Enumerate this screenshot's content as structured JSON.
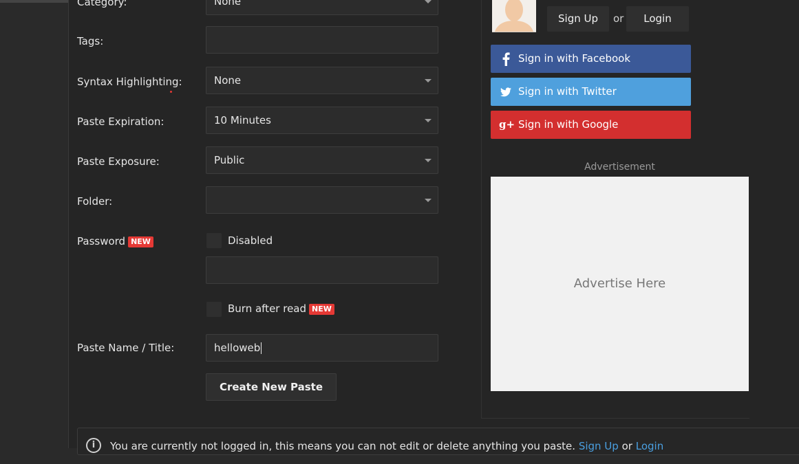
{
  "form": {
    "category": {
      "label": "Category:",
      "value": "None"
    },
    "tags": {
      "label": "Tags:",
      "value": ""
    },
    "syntax": {
      "label": "Syntax Highlighting:",
      "value": "None"
    },
    "expiration": {
      "label": "Paste Expiration:",
      "value": "10 Minutes"
    },
    "exposure": {
      "label": "Paste Exposure:",
      "value": "Public"
    },
    "folder": {
      "label": "Folder:",
      "value": ""
    },
    "password": {
      "label": "Password",
      "badge": "NEW",
      "checkbox_label": "Disabled",
      "value": ""
    },
    "burn": {
      "label": "Burn after read",
      "badge": "NEW"
    },
    "title": {
      "label": "Paste Name / Title:",
      "value": "helloweb"
    },
    "submit_label": "Create New Paste"
  },
  "auth": {
    "signup_label": "Sign Up",
    "or_text": "or",
    "login_label": "Login",
    "facebook_label": "Sign in with Facebook",
    "twitter_label": "Sign in with Twitter",
    "google_label": "Sign in with Google"
  },
  "ad": {
    "label": "Advertisement",
    "placeholder": "Advertise Here"
  },
  "notice": {
    "text": "You are currently not logged in, this means you can not edit or delete anything you paste.",
    "signup_link": "Sign Up",
    "or_text": "or",
    "login_link": "Login"
  },
  "colors": {
    "facebook": "#3b5998",
    "twitter": "#4fa0dd",
    "google": "#d32f2f",
    "badge": "#e53935",
    "link": "#4a9fe0"
  },
  "icons": [
    "facebook-icon",
    "twitter-icon",
    "google-plus-icon",
    "info-icon",
    "chevron-down-icon"
  ]
}
